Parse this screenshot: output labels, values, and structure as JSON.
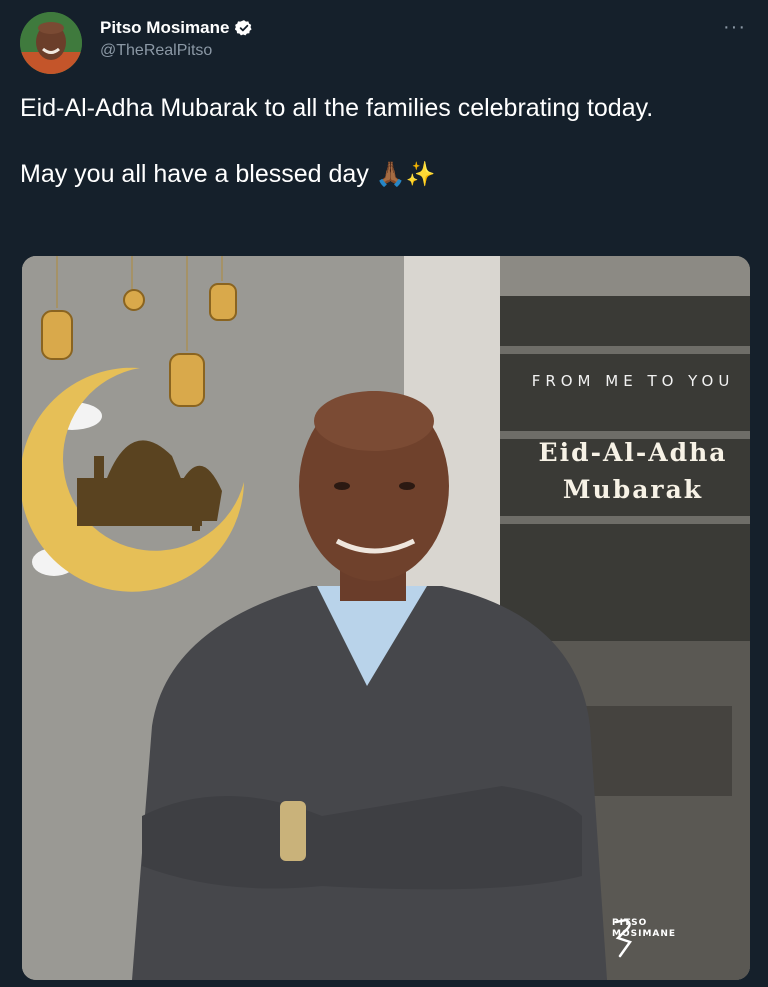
{
  "author": {
    "display_name": "Pitso Mosimane",
    "handle": "@TheRealPitso",
    "verified": true
  },
  "more_label": "···",
  "tweet": {
    "line1": "Eid-Al-Adha Mubarak to all the families celebrating today.",
    "line2": "May you all have a blessed day",
    "emojis": "🙏🏾✨"
  },
  "media": {
    "greeting_small": "FROM ME TO YOU",
    "greeting_big": "Eid-Al-Adha Mubarak",
    "brand_line1": "PITSO",
    "brand_line2": "MOSIMANE"
  },
  "colors": {
    "background": "#15202b",
    "text": "#ffffff",
    "secondary_text": "#8b98a5",
    "gold": "#e0b24a"
  }
}
